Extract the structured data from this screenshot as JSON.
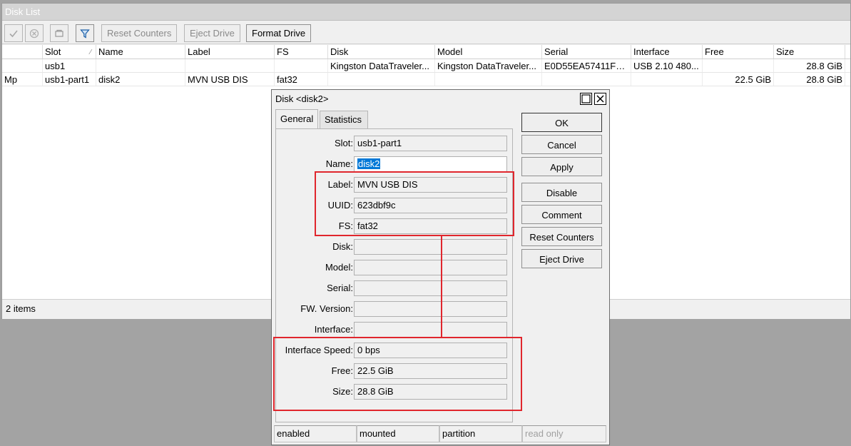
{
  "window": {
    "title": "Disk List",
    "toolbar": {
      "icons": [
        "check-icon",
        "cross-icon",
        "note-icon",
        "filter-icon"
      ],
      "reset_counters": "Reset Counters",
      "eject_drive": "Eject Drive",
      "format_drive": "Format Drive"
    },
    "columns": [
      "",
      "Slot",
      "Name",
      "Label",
      "FS",
      "Disk",
      "Model",
      "Serial",
      "Interface",
      "Free",
      "Size"
    ],
    "rows": [
      {
        "flag": "",
        "slot": "usb1",
        "name": "",
        "label": "",
        "fs": "",
        "disk": "Kingston DataTraveler...",
        "model": "Kingston DataTraveler...",
        "serial": "E0D55EA57411F4...",
        "interface": "USB 2.10 480...",
        "free": "",
        "size": "28.8 GiB"
      },
      {
        "flag": "Mp",
        "slot": "usb1-part1",
        "name": "disk2",
        "label": "MVN USB DIS",
        "fs": "fat32",
        "disk": "",
        "model": "",
        "serial": "",
        "interface": "",
        "free": "22.5 GiB",
        "size": "28.8 GiB"
      }
    ],
    "status": "2 items"
  },
  "dialog": {
    "title": "Disk <disk2>",
    "tabs": [
      "General",
      "Statistics"
    ],
    "fields": {
      "slot": {
        "label": "Slot:",
        "value": "usb1-part1"
      },
      "name": {
        "label": "Name:",
        "value": "disk2"
      },
      "label": {
        "label": "Label:",
        "value": "MVN USB DIS"
      },
      "uuid": {
        "label": "UUID:",
        "value": "623dbf9c"
      },
      "fs": {
        "label": "FS:",
        "value": "fat32"
      },
      "disk": {
        "label": "Disk:",
        "value": ""
      },
      "model": {
        "label": "Model:",
        "value": ""
      },
      "serial": {
        "label": "Serial:",
        "value": ""
      },
      "fw_version": {
        "label": "FW. Version:",
        "value": ""
      },
      "interface": {
        "label": "Interface:",
        "value": ""
      },
      "interface_speed": {
        "label": "Interface Speed:",
        "value": "0 bps"
      },
      "free": {
        "label": "Free:",
        "value": "22.5 GiB"
      },
      "size": {
        "label": "Size:",
        "value": "28.8 GiB"
      }
    },
    "buttons": {
      "ok": "OK",
      "cancel": "Cancel",
      "apply": "Apply",
      "disable": "Disable",
      "comment": "Comment",
      "reset_counters": "Reset Counters",
      "eject_drive": "Eject Drive"
    },
    "status": [
      "enabled",
      "mounted",
      "partition",
      "read only"
    ],
    "highlight_color": "#e0262d"
  }
}
